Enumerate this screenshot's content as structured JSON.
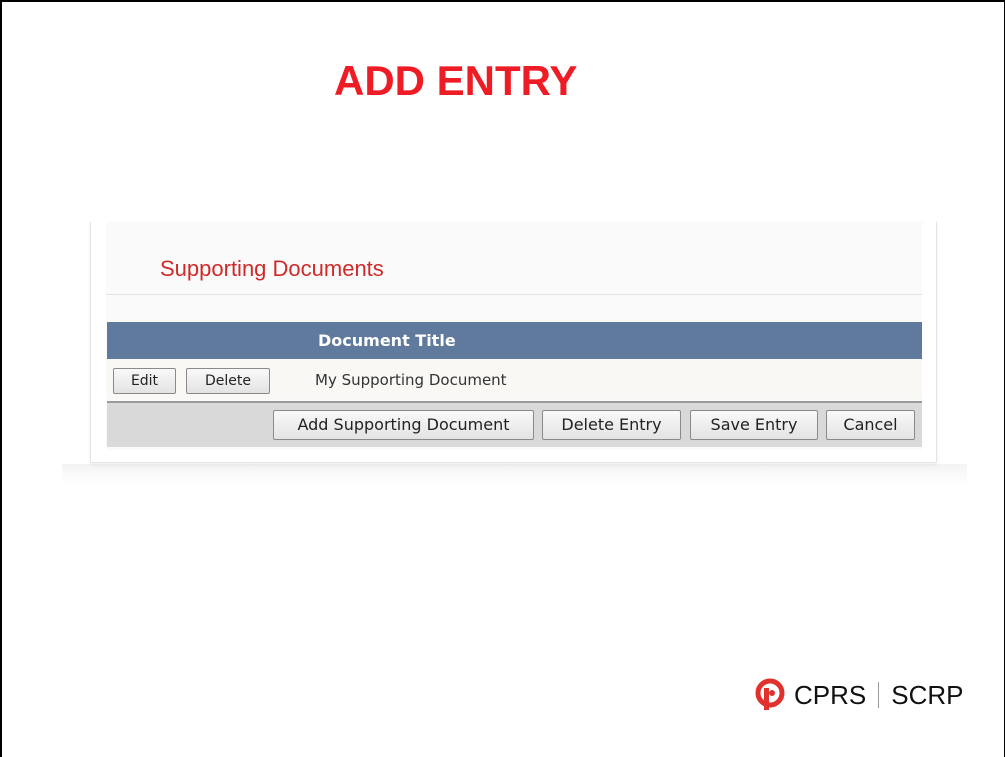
{
  "slide": {
    "title": "ADD ENTRY",
    "title_color": "#ee1c24"
  },
  "panel": {
    "section_heading": "Supporting Documents",
    "heading_color": "#cf2a2a",
    "table": {
      "header_color": "#5f7a9c",
      "columns": [
        "Document Title"
      ],
      "rows": [
        {
          "edit_label": "Edit",
          "delete_label": "Delete",
          "document_title": "My Supporting Document"
        }
      ]
    },
    "actions": {
      "add_document_label": "Add Supporting Document",
      "delete_entry_label": "Delete Entry",
      "save_entry_label": "Save Entry",
      "cancel_label": "Cancel"
    }
  },
  "logo": {
    "icon": "cprs-logo-icon",
    "brand_en": "CPRS",
    "brand_fr": "SCRP",
    "accent_color": "#e0312c"
  }
}
